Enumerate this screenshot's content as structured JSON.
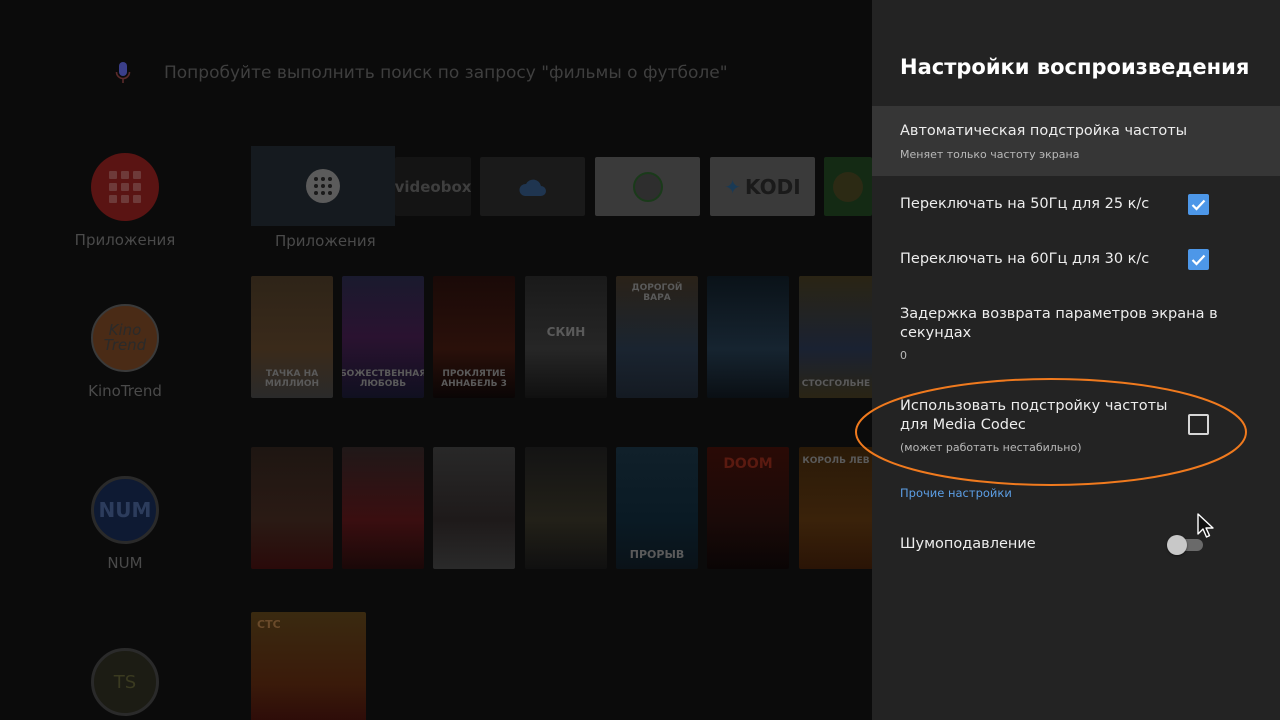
{
  "launcher": {
    "search_hint": "Попробуйте выполнить поиск по запросу \"фильмы о футболе\"",
    "channels": [
      {
        "label": "Приложения",
        "icon": "apps-grid-icon"
      },
      {
        "label": "KinoTrend",
        "logo_text": "Kino Trend"
      },
      {
        "label": "NUM",
        "logo_text": "NUM"
      },
      {
        "label": "",
        "logo_text": "TS"
      }
    ],
    "apps": {
      "focused_label": "Приложения",
      "tiles": [
        {
          "name": "Videobox",
          "label": "videobox"
        },
        {
          "name": "cloud-app",
          "label": ""
        },
        {
          "name": "green-4-app",
          "label": ""
        },
        {
          "name": "Kodi",
          "label": "KODI"
        },
        {
          "name": "ts-app",
          "label": ""
        }
      ]
    },
    "posters_row1": [
      "ТАЧКА НА МИЛЛИОН",
      "БОЖЕСТВЕННАЯ ЛЮБОВЬ",
      "ПРОКЛЯТИЕ АННАБЕЛЬ 3",
      "СКИН",
      "ДОРОГОЙ ВАРА",
      "",
      "",
      "СТОСГОЛЬНЕ"
    ],
    "posters_row2": [
      "",
      "",
      "",
      "",
      "ПРОРЫВ",
      "DOOM",
      "КОРОЛЬ ЛЕВ"
    ],
    "poster_row3": "СТС"
  },
  "panel": {
    "title": "Настройки воспроизведения",
    "auto_refresh": {
      "title": "Автоматическая подстройка частоты",
      "subtitle": "Меняет только частоту экрана"
    },
    "switch_50": {
      "title": "Переключать на 50Гц для 25 к/с",
      "checked": true
    },
    "switch_60": {
      "title": "Переключать на 60Гц для 30 к/с",
      "checked": true
    },
    "delay": {
      "title": "Задержка возврата параметров экрана в секундах",
      "value": "0"
    },
    "media_codec": {
      "title": "Использовать подстройку частоты для Media Codec",
      "subtitle": "(может работать нестабильно)",
      "checked": false
    },
    "other_section": "Прочие настройки",
    "noise": {
      "title": "Шумоподавление",
      "enabled": false
    }
  },
  "colors": {
    "panel_bg": "#232323",
    "highlight_bg": "#363636",
    "accent_blue": "#4d97e8",
    "section_blue": "#5c9fe6",
    "annotation_orange": "#f07a1e"
  }
}
